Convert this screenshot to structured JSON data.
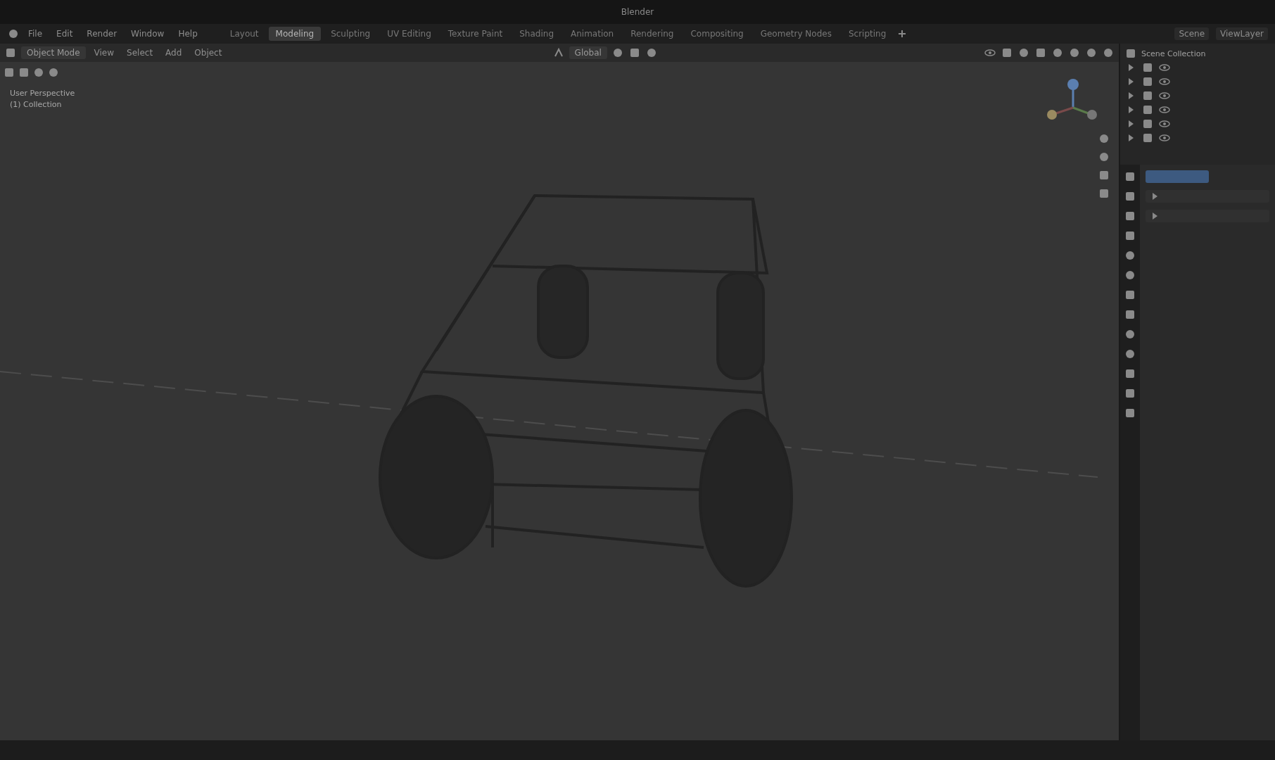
{
  "window": {
    "title": "Blender"
  },
  "menu": [
    "File",
    "Edit",
    "Render",
    "Window",
    "Help"
  ],
  "workspaces": [
    {
      "label": "Layout",
      "selected": false
    },
    {
      "label": "Modeling",
      "selected": true
    },
    {
      "label": "Sculpting",
      "selected": false
    },
    {
      "label": "UV Editing",
      "selected": false
    },
    {
      "label": "Texture Paint",
      "selected": false
    },
    {
      "label": "Shading",
      "selected": false
    },
    {
      "label": "Animation",
      "selected": false
    },
    {
      "label": "Rendering",
      "selected": false
    },
    {
      "label": "Compositing",
      "selected": false
    },
    {
      "label": "Geometry Nodes",
      "selected": false
    },
    {
      "label": "Scripting",
      "selected": false
    }
  ],
  "scene": {
    "scene": "Scene",
    "view_layer": "ViewLayer"
  },
  "header": {
    "mode": "Object Mode",
    "menus": [
      "View",
      "Select",
      "Add",
      "Object"
    ],
    "orientation": "Global"
  },
  "viewport": {
    "view_name": "User Perspective",
    "collection": "(1) Collection"
  },
  "outliner": {
    "root": "Scene Collection"
  }
}
